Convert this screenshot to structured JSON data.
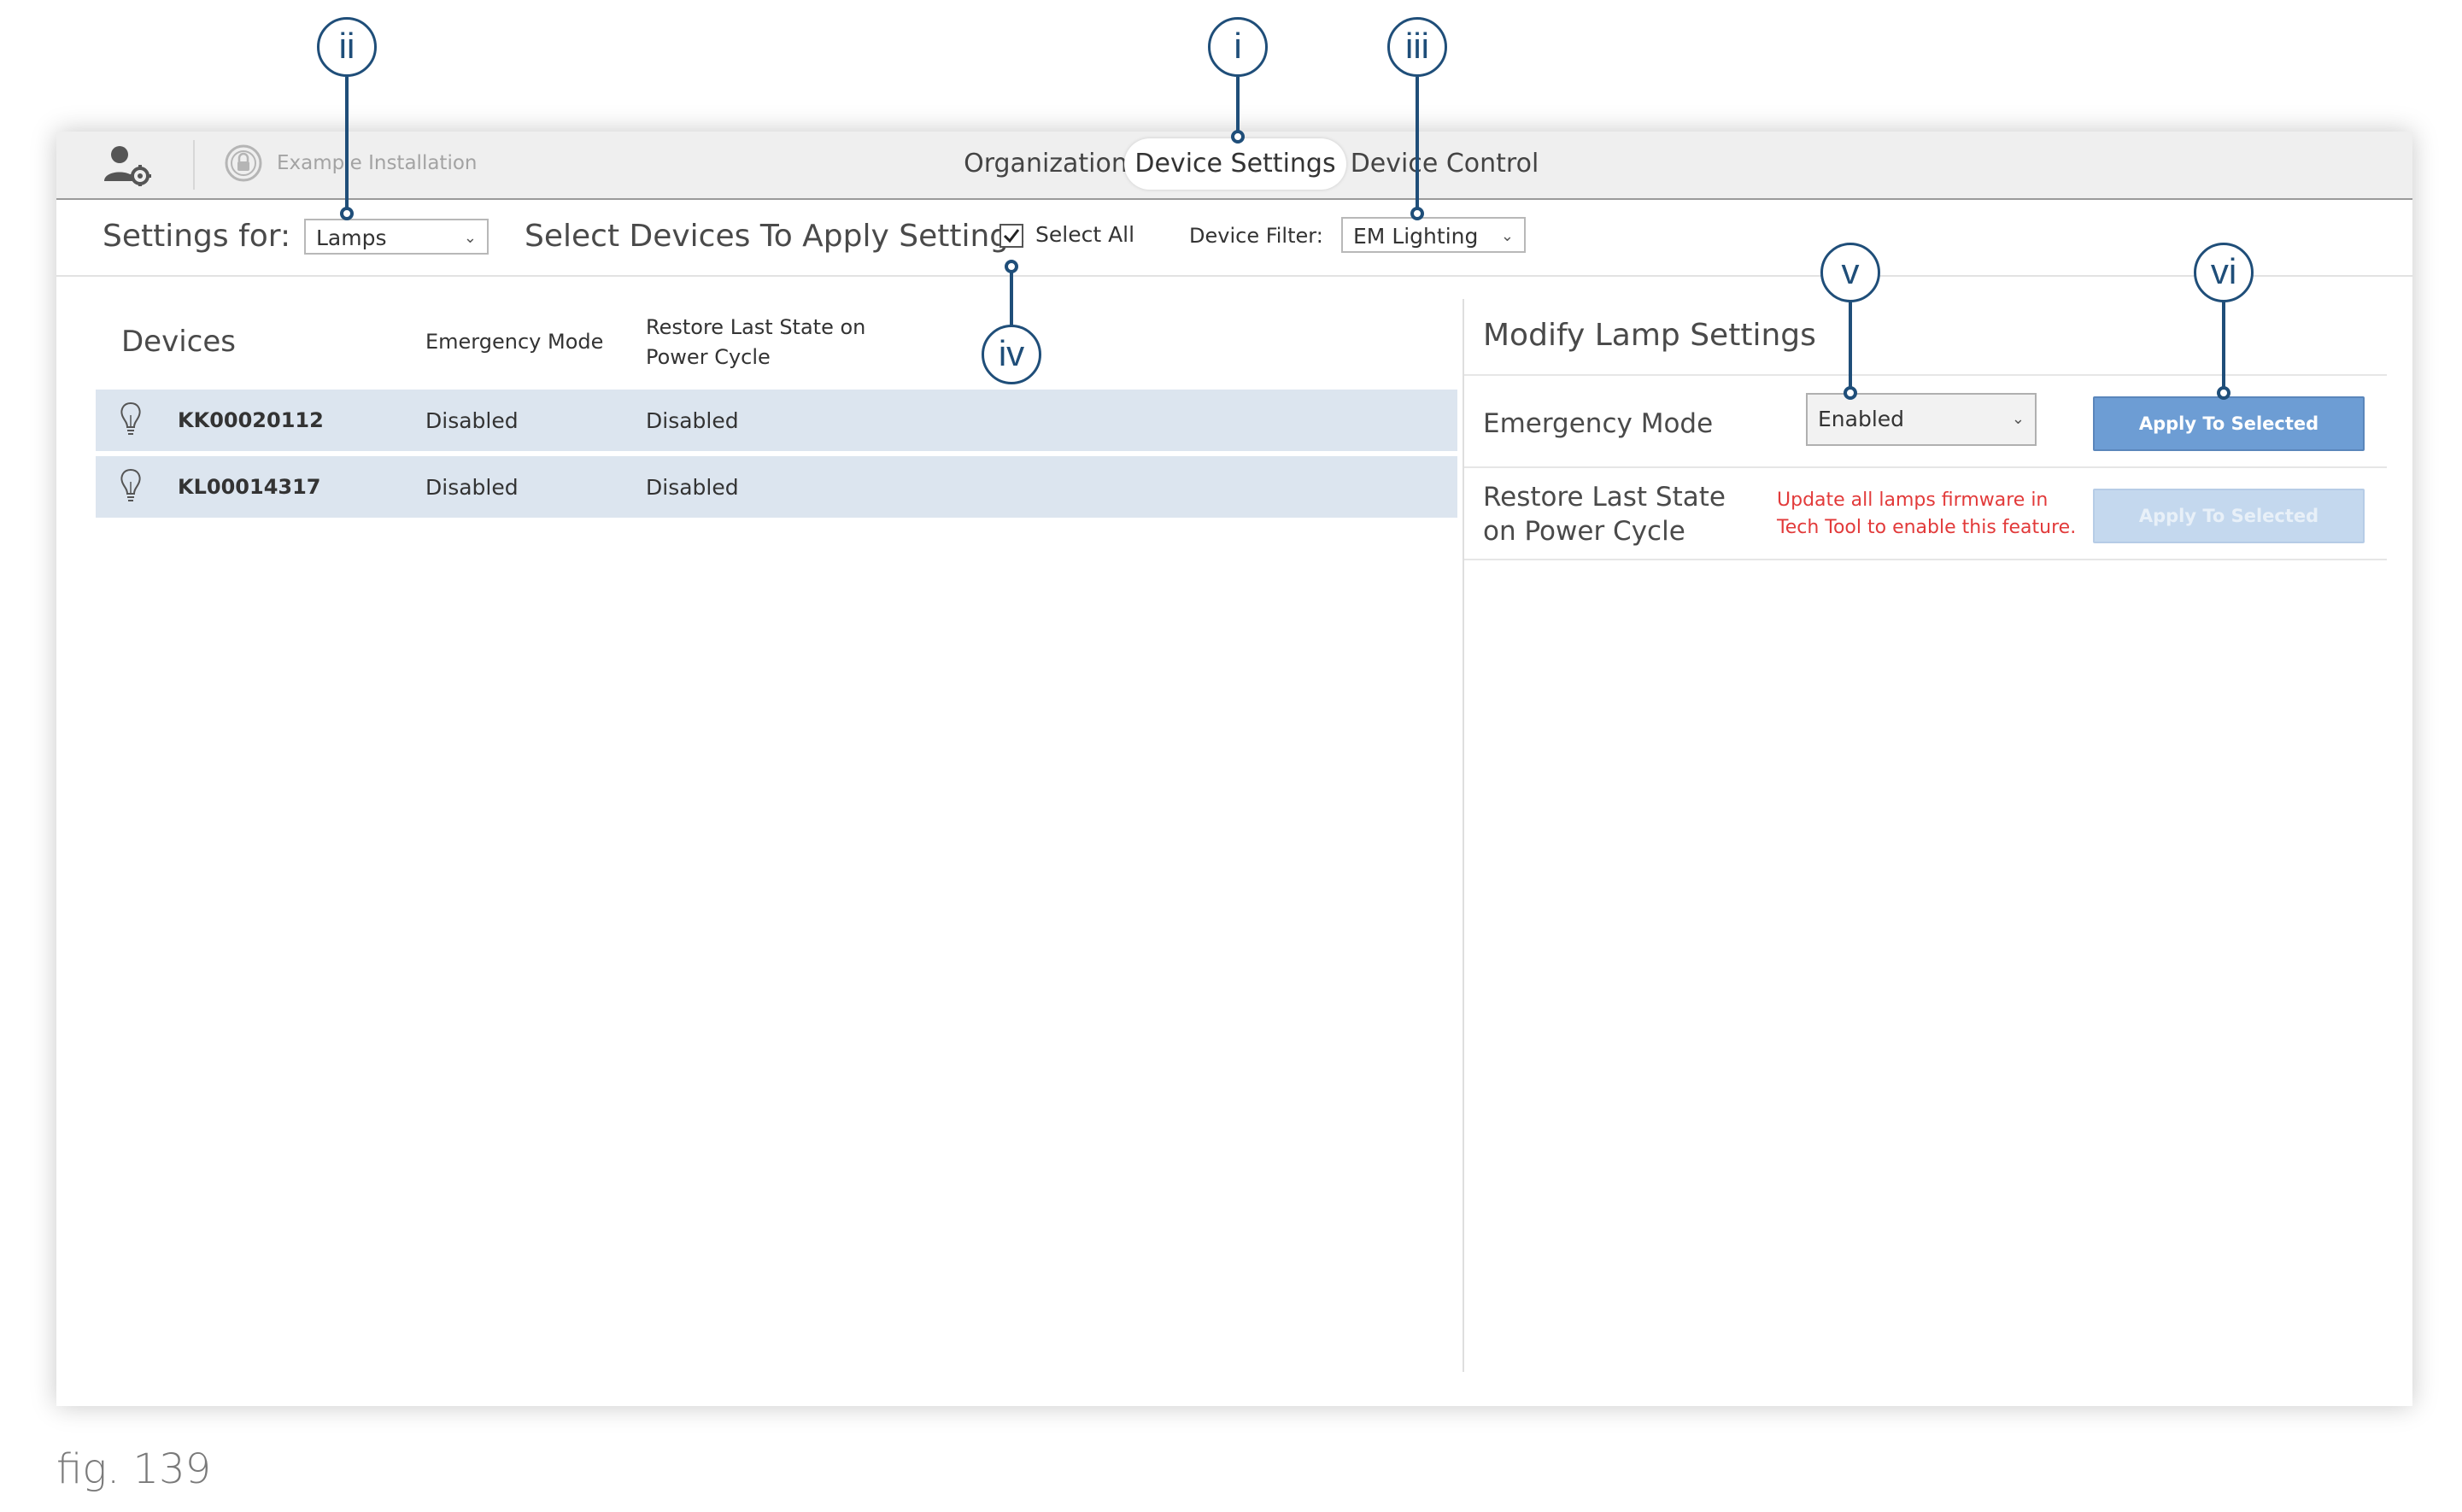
{
  "topbar": {
    "installation_name": "Example Installation",
    "tabs": [
      {
        "label": "Organization"
      },
      {
        "label": "Device Settings",
        "active": true
      },
      {
        "label": "Device Control"
      }
    ]
  },
  "settings_bar": {
    "settings_for_label": "Settings for:",
    "device_type_value": "Lamps",
    "select_devices_heading": "Select Devices To Apply Settings",
    "select_all_label": "Select All",
    "select_all_checked": true,
    "device_filter_label": "Device Filter:",
    "device_filter_value": "EM Lighting"
  },
  "devices": {
    "heading": "Devices",
    "columns": [
      "Emergency Mode",
      "Restore Last State on Power Cycle"
    ],
    "rows": [
      {
        "id": "KK00020112",
        "emergency_mode": "Disabled",
        "restore_last_state": "Disabled"
      },
      {
        "id": "KL00014317",
        "emergency_mode": "Disabled",
        "restore_last_state": "Disabled"
      }
    ]
  },
  "modify": {
    "heading": "Modify Lamp Settings",
    "emergency_mode_label": "Emergency Mode",
    "emergency_mode_value": "Enabled",
    "apply_label": "Apply To Selected",
    "restore_label": "Restore Last State on Power Cycle",
    "firmware_warning": "Update all lamps firmware in Tech Tool to enable this feature.",
    "apply_restore_label": "Apply To Selected",
    "apply_restore_enabled": false
  },
  "callouts": [
    "i",
    "ii",
    "iii",
    "iv",
    "v",
    "vi"
  ],
  "caption": "fig. 139",
  "colors": {
    "accent": "#1f4e79",
    "button": "#6d9dd4",
    "button_disabled": "#c4d8ee",
    "row_highlight": "#dce5ef",
    "warning": "#e23a3a"
  }
}
